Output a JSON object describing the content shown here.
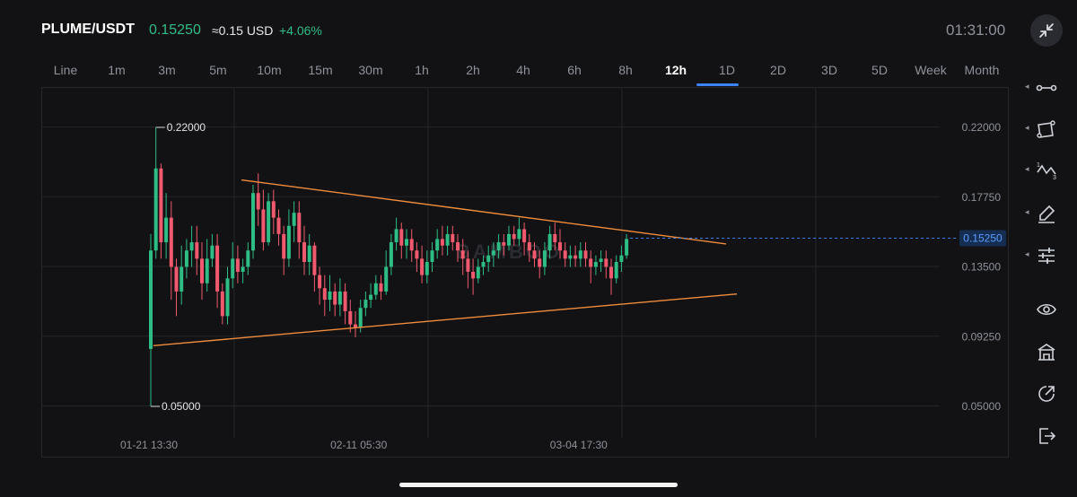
{
  "header": {
    "pair": "PLUME/USDT",
    "price": "0.15250",
    "approx": "≈0.15 USD",
    "change": "+4.06%",
    "clock": "01:31:00"
  },
  "tabs": [
    {
      "label": "Line"
    },
    {
      "label": "1m"
    },
    {
      "label": "3m"
    },
    {
      "label": "5m"
    },
    {
      "label": "10m"
    },
    {
      "label": "15m"
    },
    {
      "label": "30m"
    },
    {
      "label": "1h"
    },
    {
      "label": "2h"
    },
    {
      "label": "4h"
    },
    {
      "label": "6h"
    },
    {
      "label": "8h"
    },
    {
      "label": "12h",
      "active": true
    },
    {
      "label": "1D"
    },
    {
      "label": "2D"
    },
    {
      "label": "3D"
    },
    {
      "label": "5D"
    },
    {
      "label": "Week"
    },
    {
      "label": "Month"
    }
  ],
  "toolbar": [
    "line-tool-icon",
    "shape-tool-icon",
    "wave-tool-icon",
    "brush-icon",
    "settings-sliders-icon",
    "eye-icon",
    "building-icon",
    "share-icon",
    "exit-icon"
  ],
  "chart_data": {
    "type": "candlestick",
    "y_ticks": [
      "0.22000",
      "0.17750",
      "0.13500",
      "0.09250",
      "0.05000"
    ],
    "ylim": [
      0.05,
      0.22
    ],
    "x_ticks": [
      {
        "label": "01-21 13:30",
        "index": 0
      },
      {
        "label": "02-11 05:30",
        "index": 41
      },
      {
        "label": "03-04 17:30",
        "index": 84
      }
    ],
    "current_price": "0.15250",
    "high_label": "0.22000",
    "low_label": "0.05000",
    "watermark": "BAMBOO",
    "colors": {
      "up": "#2ebd85",
      "down": "#f0596e",
      "trend": "#f08c3c",
      "price_line": "#3b82f6",
      "grid": "#242529"
    },
    "candles": [
      [
        0.085,
        0.145,
        0.05,
        0.155
      ],
      [
        0.145,
        0.195,
        0.14,
        0.22
      ],
      [
        0.195,
        0.15,
        0.14,
        0.198
      ],
      [
        0.15,
        0.165,
        0.14,
        0.18
      ],
      [
        0.165,
        0.135,
        0.115,
        0.175
      ],
      [
        0.135,
        0.12,
        0.105,
        0.14
      ],
      [
        0.12,
        0.135,
        0.112,
        0.148
      ],
      [
        0.135,
        0.145,
        0.128,
        0.152
      ],
      [
        0.145,
        0.15,
        0.135,
        0.16
      ],
      [
        0.15,
        0.14,
        0.13,
        0.16
      ],
      [
        0.14,
        0.125,
        0.115,
        0.15
      ],
      [
        0.125,
        0.14,
        0.12,
        0.152
      ],
      [
        0.14,
        0.148,
        0.135,
        0.155
      ],
      [
        0.148,
        0.12,
        0.11,
        0.155
      ],
      [
        0.12,
        0.105,
        0.1,
        0.125
      ],
      [
        0.105,
        0.128,
        0.1,
        0.135
      ],
      [
        0.128,
        0.14,
        0.122,
        0.15
      ],
      [
        0.14,
        0.132,
        0.125,
        0.148
      ],
      [
        0.132,
        0.135,
        0.125,
        0.14
      ],
      [
        0.135,
        0.145,
        0.13,
        0.15
      ],
      [
        0.145,
        0.18,
        0.14,
        0.185
      ],
      [
        0.18,
        0.17,
        0.16,
        0.192
      ],
      [
        0.17,
        0.15,
        0.145,
        0.182
      ],
      [
        0.15,
        0.175,
        0.148,
        0.18
      ],
      [
        0.175,
        0.165,
        0.155,
        0.182
      ],
      [
        0.165,
        0.155,
        0.148,
        0.17
      ],
      [
        0.155,
        0.14,
        0.13,
        0.16
      ],
      [
        0.14,
        0.16,
        0.135,
        0.17
      ],
      [
        0.16,
        0.168,
        0.15,
        0.175
      ],
      [
        0.168,
        0.15,
        0.14,
        0.175
      ],
      [
        0.15,
        0.138,
        0.13,
        0.16
      ],
      [
        0.138,
        0.148,
        0.13,
        0.155
      ],
      [
        0.148,
        0.13,
        0.12,
        0.15
      ],
      [
        0.13,
        0.122,
        0.112,
        0.135
      ],
      [
        0.122,
        0.115,
        0.105,
        0.13
      ],
      [
        0.115,
        0.12,
        0.108,
        0.13
      ],
      [
        0.12,
        0.112,
        0.105,
        0.125
      ],
      [
        0.112,
        0.12,
        0.105,
        0.128
      ],
      [
        0.12,
        0.108,
        0.1,
        0.125
      ],
      [
        0.108,
        0.1,
        0.095,
        0.115
      ],
      [
        0.1,
        0.098,
        0.092,
        0.108
      ],
      [
        0.098,
        0.11,
        0.095,
        0.115
      ],
      [
        0.11,
        0.115,
        0.105,
        0.12
      ],
      [
        0.115,
        0.118,
        0.11,
        0.125
      ],
      [
        0.118,
        0.125,
        0.115,
        0.13
      ],
      [
        0.125,
        0.12,
        0.115,
        0.13
      ],
      [
        0.12,
        0.135,
        0.118,
        0.145
      ],
      [
        0.135,
        0.15,
        0.13,
        0.155
      ],
      [
        0.15,
        0.158,
        0.145,
        0.165
      ],
      [
        0.158,
        0.148,
        0.14,
        0.162
      ],
      [
        0.148,
        0.152,
        0.14,
        0.158
      ],
      [
        0.152,
        0.145,
        0.138,
        0.158
      ],
      [
        0.145,
        0.14,
        0.132,
        0.15
      ],
      [
        0.14,
        0.13,
        0.125,
        0.148
      ],
      [
        0.13,
        0.138,
        0.125,
        0.145
      ],
      [
        0.138,
        0.145,
        0.132,
        0.15
      ],
      [
        0.145,
        0.152,
        0.14,
        0.158
      ],
      [
        0.152,
        0.148,
        0.142,
        0.16
      ],
      [
        0.148,
        0.155,
        0.142,
        0.16
      ],
      [
        0.155,
        0.15,
        0.145,
        0.16
      ],
      [
        0.15,
        0.145,
        0.138,
        0.155
      ],
      [
        0.145,
        0.14,
        0.13,
        0.152
      ],
      [
        0.14,
        0.132,
        0.122,
        0.145
      ],
      [
        0.132,
        0.128,
        0.118,
        0.14
      ],
      [
        0.128,
        0.135,
        0.125,
        0.14
      ],
      [
        0.135,
        0.138,
        0.13,
        0.142
      ],
      [
        0.138,
        0.142,
        0.132,
        0.148
      ],
      [
        0.142,
        0.145,
        0.135,
        0.15
      ],
      [
        0.145,
        0.15,
        0.14,
        0.155
      ],
      [
        0.15,
        0.148,
        0.142,
        0.155
      ],
      [
        0.148,
        0.155,
        0.145,
        0.16
      ],
      [
        0.155,
        0.152,
        0.148,
        0.16
      ],
      [
        0.152,
        0.158,
        0.148,
        0.165
      ],
      [
        0.158,
        0.15,
        0.142,
        0.162
      ],
      [
        0.15,
        0.145,
        0.138,
        0.155
      ],
      [
        0.145,
        0.14,
        0.135,
        0.15
      ],
      [
        0.14,
        0.135,
        0.128,
        0.145
      ],
      [
        0.135,
        0.145,
        0.13,
        0.15
      ],
      [
        0.145,
        0.155,
        0.14,
        0.16
      ],
      [
        0.155,
        0.15,
        0.145,
        0.162
      ],
      [
        0.15,
        0.145,
        0.14,
        0.158
      ],
      [
        0.145,
        0.14,
        0.135,
        0.15
      ],
      [
        0.14,
        0.142,
        0.135,
        0.148
      ],
      [
        0.142,
        0.14,
        0.135,
        0.148
      ],
      [
        0.14,
        0.145,
        0.135,
        0.15
      ],
      [
        0.145,
        0.14,
        0.135,
        0.15
      ],
      [
        0.14,
        0.135,
        0.125,
        0.145
      ],
      [
        0.135,
        0.138,
        0.13,
        0.142
      ],
      [
        0.138,
        0.14,
        0.132,
        0.145
      ],
      [
        0.14,
        0.135,
        0.128,
        0.145
      ],
      [
        0.135,
        0.128,
        0.118,
        0.14
      ],
      [
        0.128,
        0.138,
        0.125,
        0.142
      ],
      [
        0.138,
        0.142,
        0.132,
        0.148
      ],
      [
        0.142,
        0.152,
        0.14,
        0.155
      ]
    ]
  }
}
